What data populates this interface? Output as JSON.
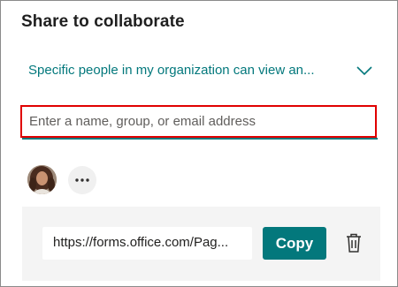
{
  "dialog": {
    "title": "Share to collaborate"
  },
  "permission_dropdown": {
    "selected": "Specific people in my organization can view an...",
    "icon": "chevron-down-icon"
  },
  "recipients_input": {
    "value": "",
    "placeholder": "Enter a name, group, or email address"
  },
  "people": {
    "avatar_icon": "user-avatar",
    "more_icon": "more-icon"
  },
  "link": {
    "url": "https://forms.office.com/Pag...",
    "copy_label": "Copy",
    "delete_icon": "trash-icon"
  },
  "colors": {
    "accent": "#03787c",
    "highlight_border": "#e00000",
    "panel_bg": "#f4f4f4"
  }
}
